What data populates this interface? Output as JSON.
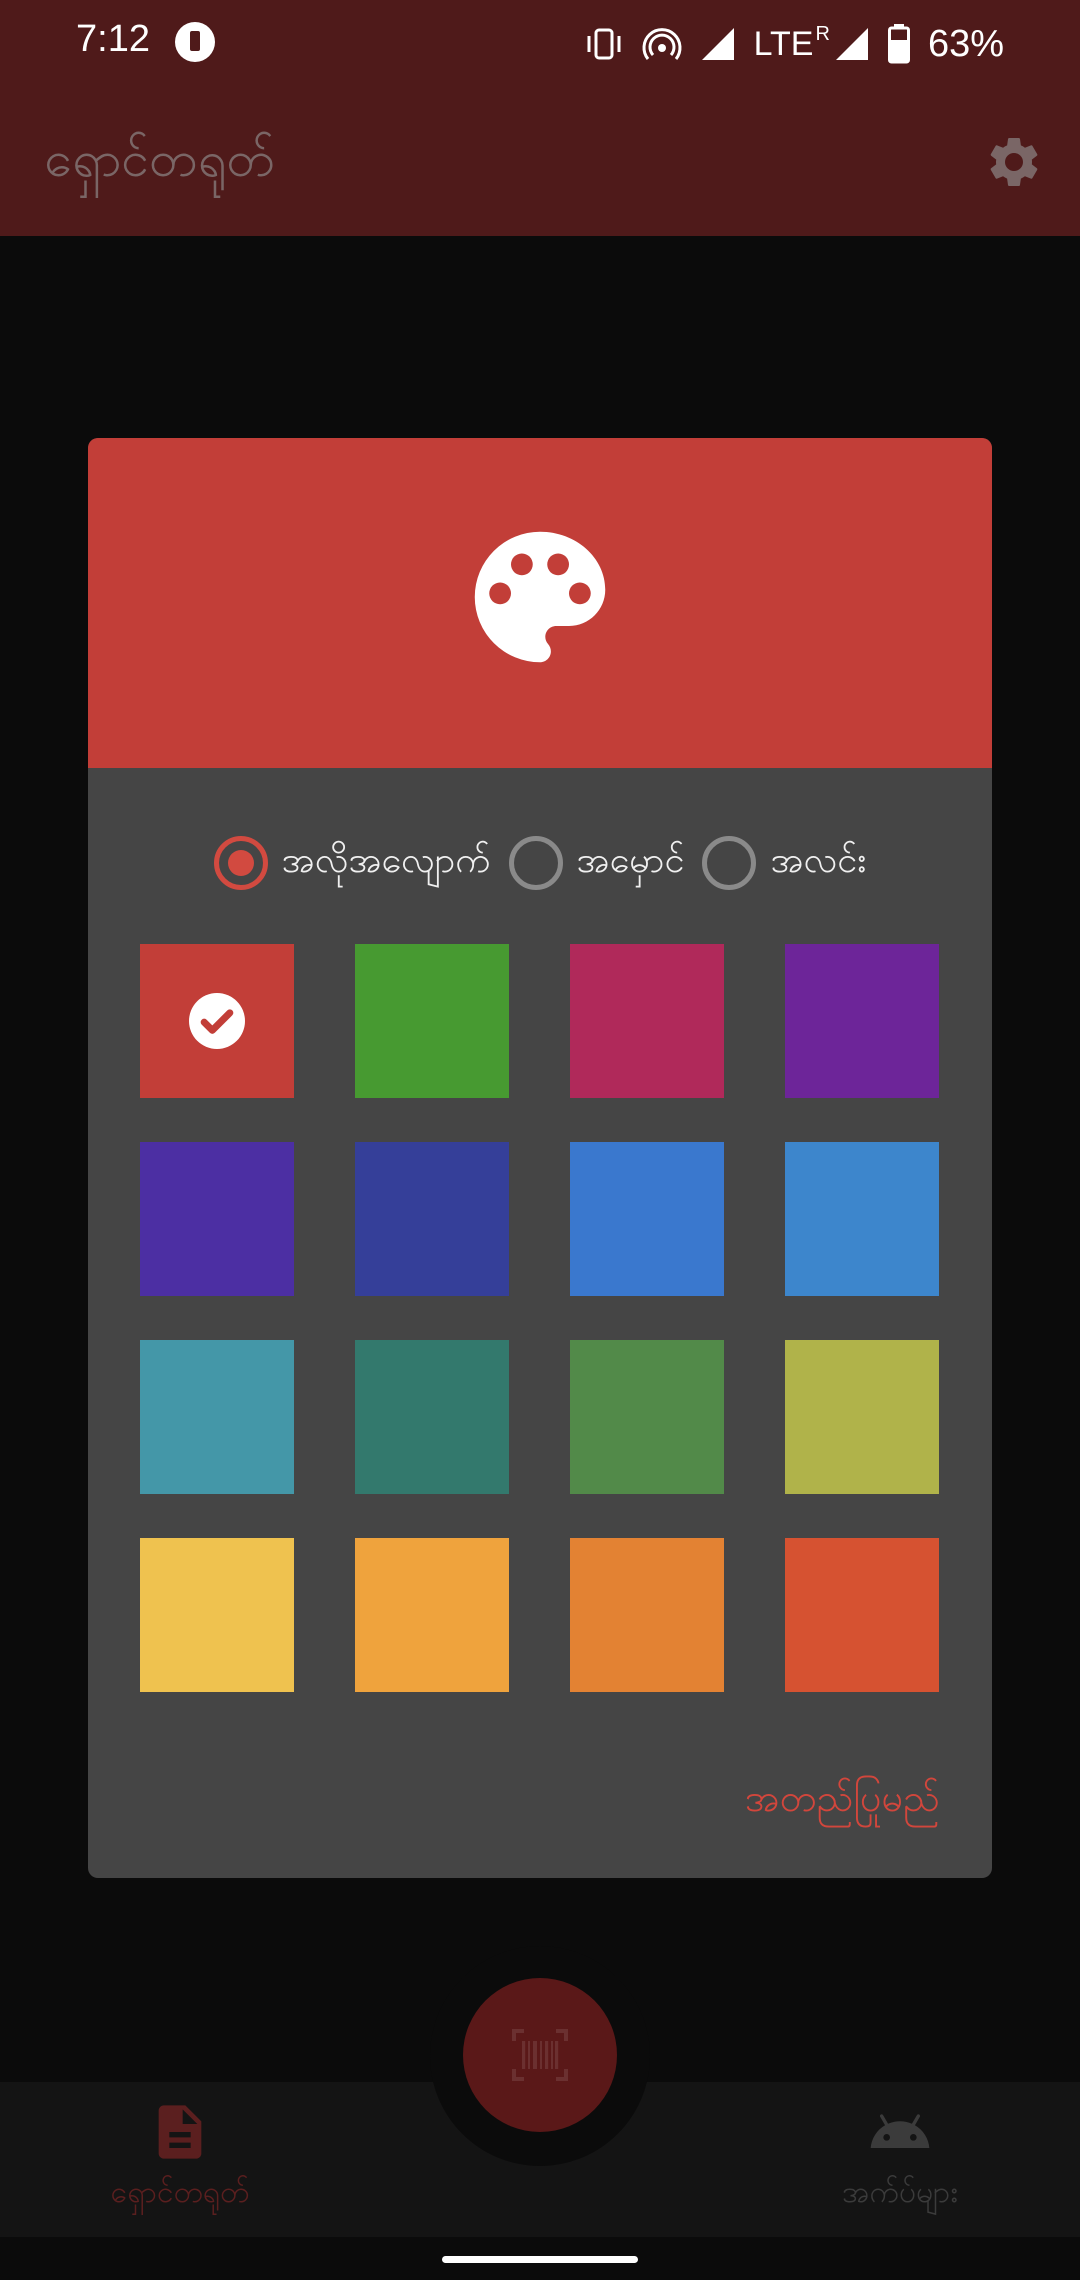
{
  "status_bar": {
    "time": "7:12",
    "network": "LTE",
    "roaming": "R",
    "battery": "63%"
  },
  "app_bar": {
    "title": "ရှောင်တရုတ်",
    "settings_icon": "gear-icon"
  },
  "dialog": {
    "header_icon": "palette-icon",
    "header_color": "#c23e38",
    "radio_options": [
      {
        "label": "အလိုအလျောက်",
        "checked": true
      },
      {
        "label": "အမှောင်",
        "checked": false
      },
      {
        "label": "အလင်း",
        "checked": false
      }
    ],
    "swatches": [
      "#c23e38",
      "#479a31",
      "#b0295a",
      "#6d2599",
      "#4c2fa3",
      "#353f99",
      "#3a78ce",
      "#3d86cc",
      "#4497a8",
      "#33796d",
      "#528a49",
      "#b0b34a",
      "#efc24f",
      "#efa33d",
      "#e38233",
      "#d65231"
    ],
    "selected_index": 0,
    "confirm_label": "အတည်ပြုမည်"
  },
  "bottom_nav": {
    "fab_icon": "barcode-scan-icon",
    "items": [
      {
        "label": "ရှောင်တရုတ်",
        "icon": "document-icon",
        "active": true
      },
      {
        "label": "အက်ပ်များ",
        "icon": "android-icon",
        "active": false
      }
    ]
  }
}
